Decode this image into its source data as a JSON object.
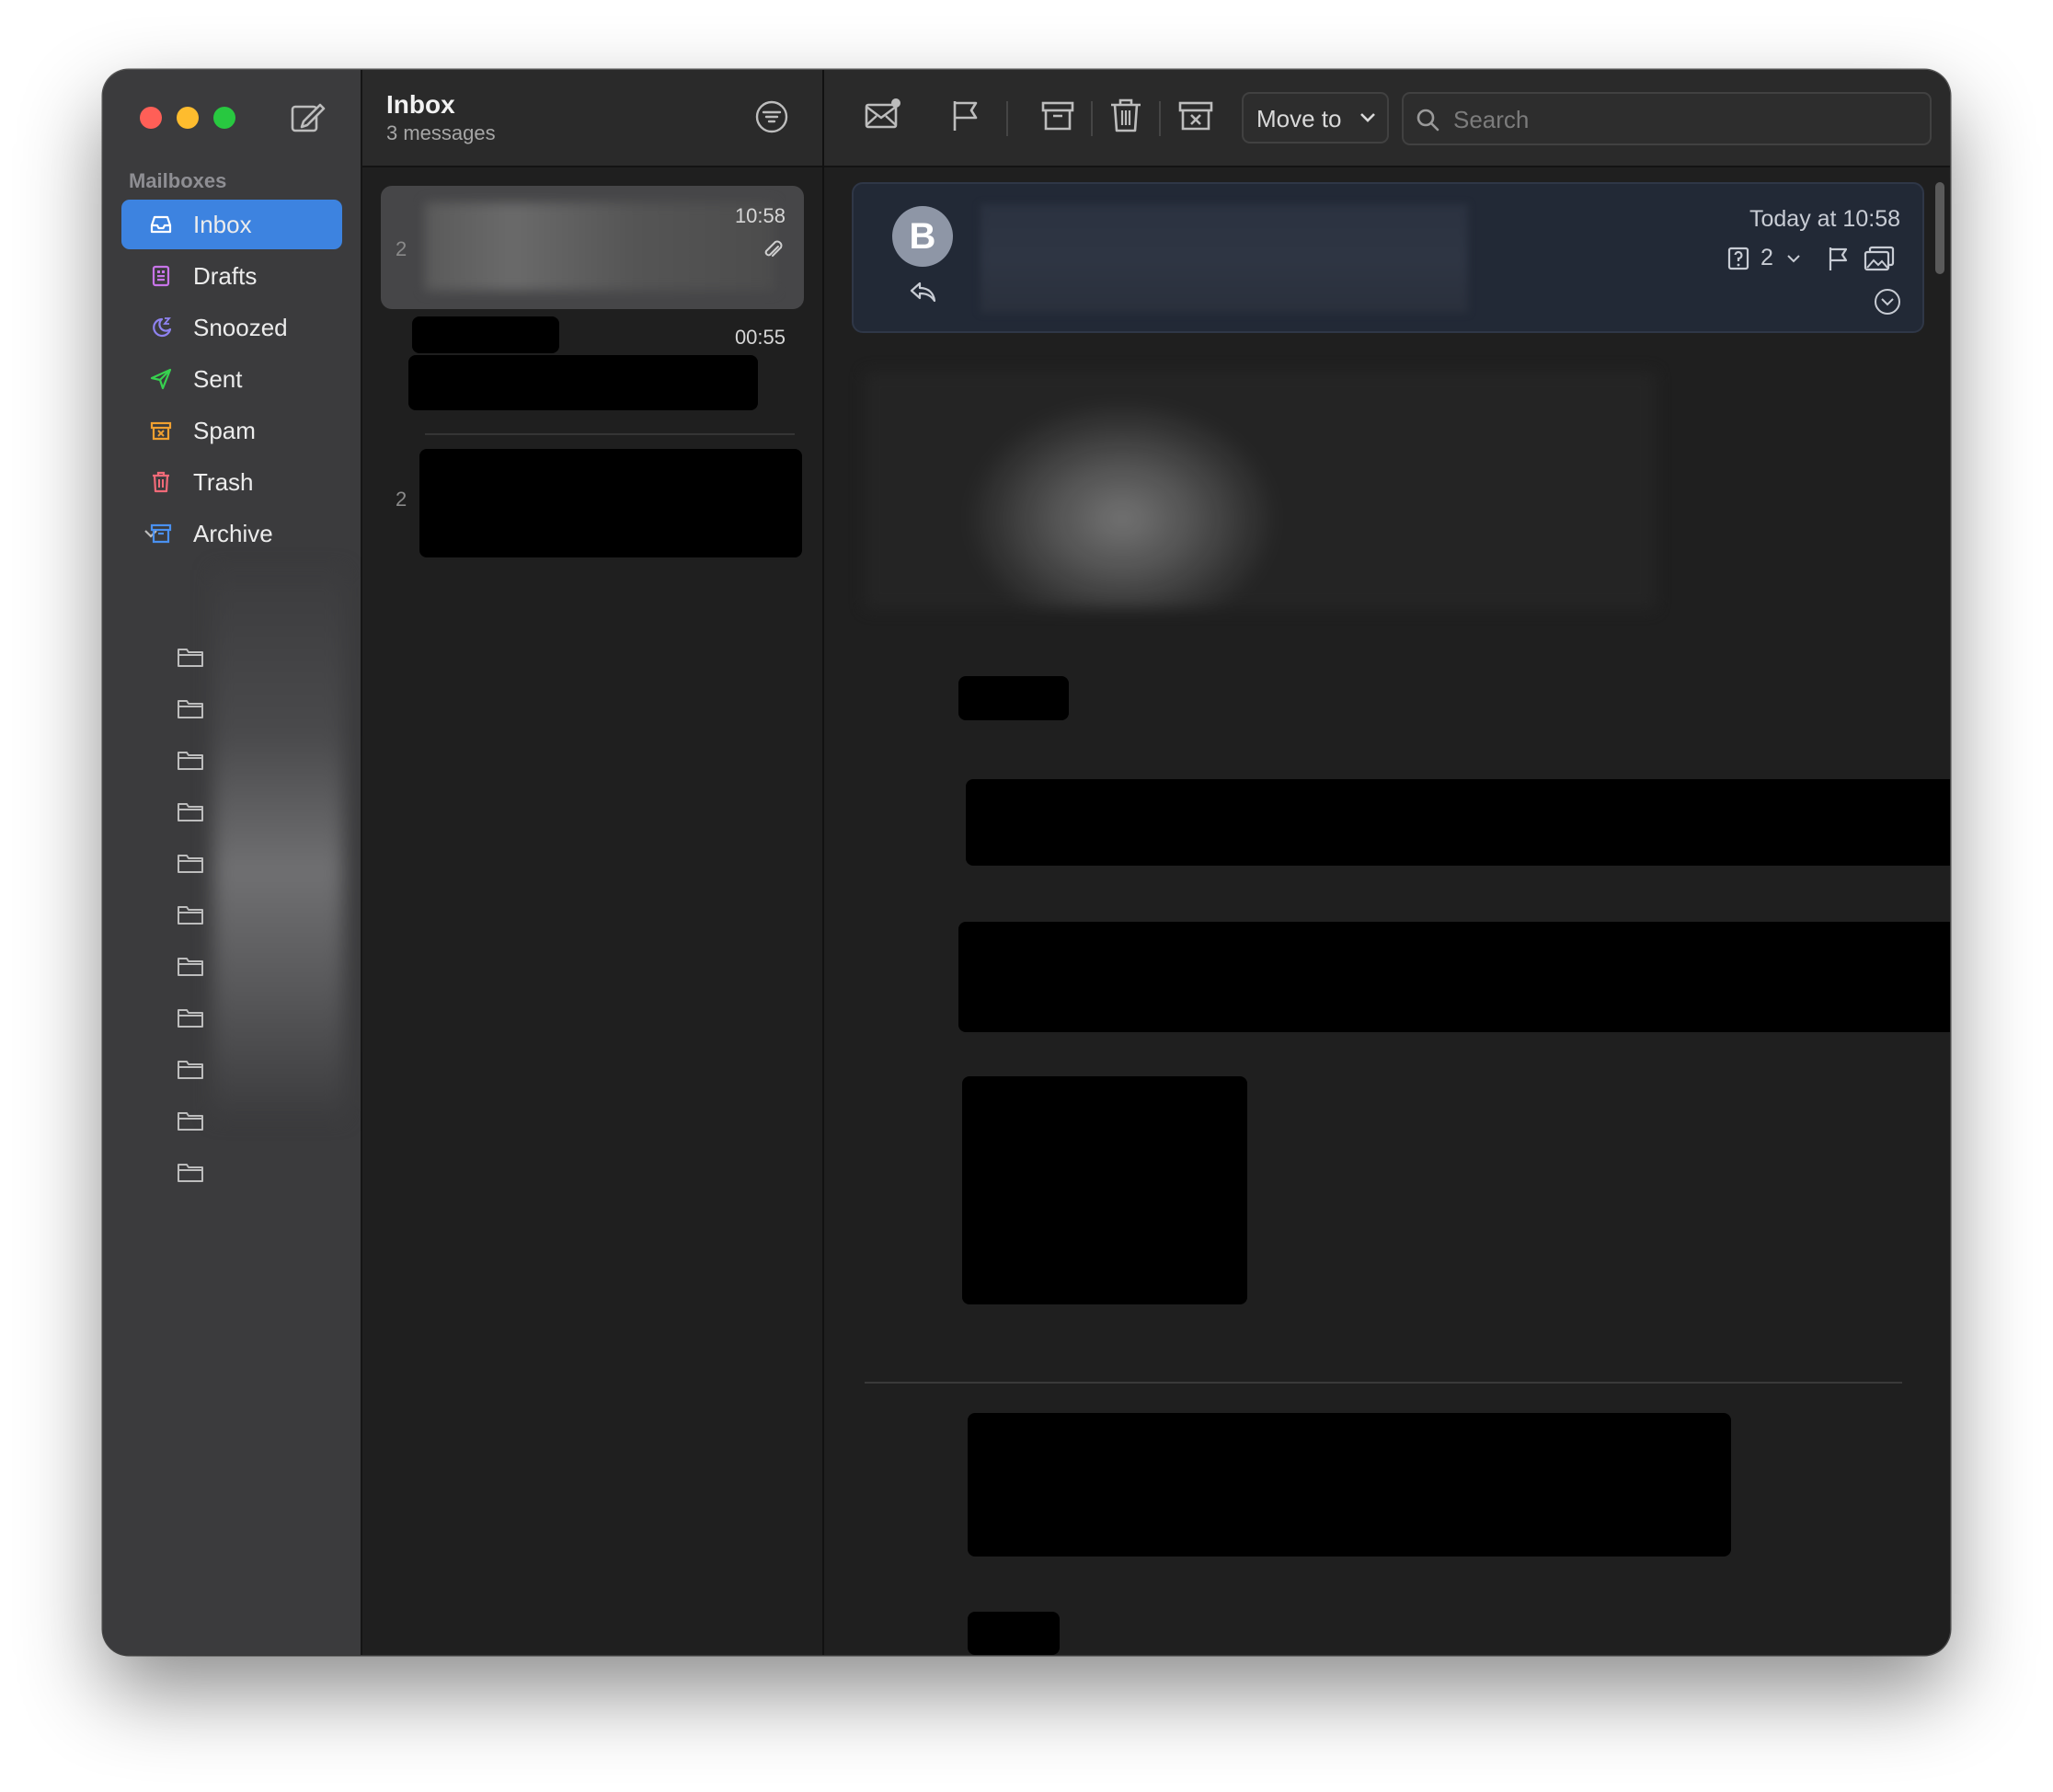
{
  "sidebar": {
    "section_label": "Mailboxes",
    "items": [
      {
        "label": "Inbox",
        "icon": "inbox-icon",
        "color": "#ffffff"
      },
      {
        "label": "Drafts",
        "icon": "drafts-icon",
        "color": "#c774e8"
      },
      {
        "label": "Snoozed",
        "icon": "snoozed-icon",
        "color": "#8e82f0"
      },
      {
        "label": "Sent",
        "icon": "sent-icon",
        "color": "#37d14f"
      },
      {
        "label": "Spam",
        "icon": "spam-icon",
        "color": "#f0a030"
      },
      {
        "label": "Trash",
        "icon": "trash-icon",
        "color": "#f06a78"
      },
      {
        "label": "Archive",
        "icon": "archive-icon",
        "color": "#4a90f0"
      }
    ],
    "archive_subfolder_count": 11,
    "accent": "#3d83e0"
  },
  "list": {
    "title": "Inbox",
    "subtitle": "3 messages",
    "messages": [
      {
        "count": "2",
        "time": "10:58",
        "has_attachment": true,
        "selected": true
      },
      {
        "count": "",
        "time": "00:55",
        "has_attachment": false,
        "selected": false
      },
      {
        "count": "2",
        "time": "",
        "has_attachment": false,
        "selected": false
      }
    ]
  },
  "toolbar": {
    "move_to_label": "Move to",
    "search_placeholder": "Search"
  },
  "message": {
    "avatar_initial": "B",
    "date": "Today at 10:58",
    "thread_count": "2"
  }
}
